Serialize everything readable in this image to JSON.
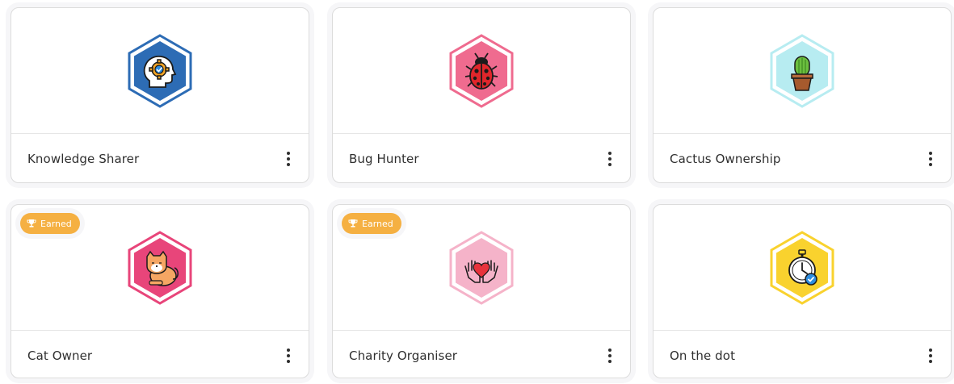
{
  "colors": {
    "earned_badge": "#f5b042",
    "card_border": "#dcdcdc",
    "text": "#2f2f2f"
  },
  "cards": [
    {
      "title": "Knowledge Sharer",
      "icon": "head-gear-icon",
      "hex_fill": "#2d6cb5",
      "hex_border": "#2d6cb5",
      "earned": false
    },
    {
      "title": "Bug Hunter",
      "icon": "ladybug-icon",
      "hex_fill": "#ef6b8f",
      "hex_border": "#ef6b8f",
      "earned": false
    },
    {
      "title": "Cactus Ownership",
      "icon": "cactus-icon",
      "hex_fill": "#b7ecf1",
      "hex_border": "#b7ecf1",
      "earned": false
    },
    {
      "title": "Cat Owner",
      "icon": "cat-icon",
      "hex_fill": "#e8457a",
      "hex_border": "#e8457a",
      "earned": true,
      "earned_label": "Earned"
    },
    {
      "title": "Charity Organiser",
      "icon": "heart-hands-icon",
      "hex_fill": "#f5b3c9",
      "hex_border": "#f5b3c9",
      "earned": true,
      "earned_label": "Earned"
    },
    {
      "title": "On the dot",
      "icon": "stopwatch-icon",
      "hex_fill": "#f9d22e",
      "hex_border": "#f9d22e",
      "earned": false
    }
  ]
}
